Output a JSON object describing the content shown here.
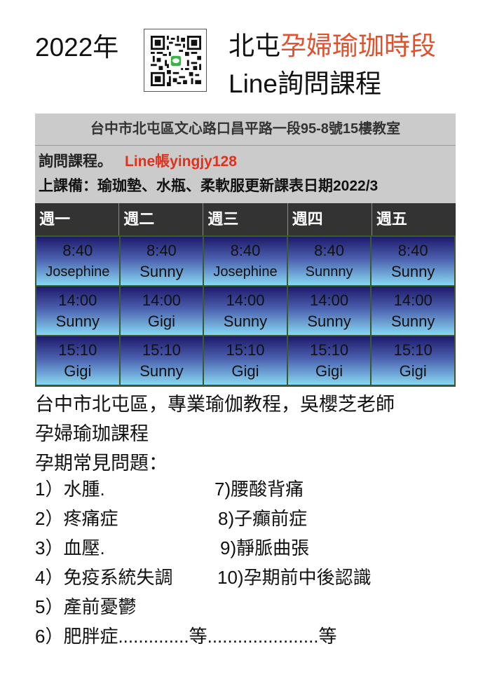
{
  "header": {
    "year": "2022年",
    "qr_icon": "line-qr-code",
    "title_prefix": "北屯",
    "title_highlight": "孕婦瑜珈時段",
    "subtitle": "Line詢問課程",
    "highlight_color": "#e0522e"
  },
  "schedule": {
    "address": "台中市北屯區文心路口昌平路一段95-8號15樓教室",
    "inquiry_label": "詢問課程。",
    "line_account": "Line帳yingjy128",
    "bring_items": "上課備：瑜珈墊、水瓶、柔軟服更新課表日期2022/3",
    "days": [
      "週一",
      "週二",
      "週三",
      "週四",
      "週五"
    ],
    "rows": [
      [
        {
          "time": "8:40",
          "teacher": "Josephine"
        },
        {
          "time": "8:40",
          "teacher": "Sunny"
        },
        {
          "time": "8:40",
          "teacher": "Josephine"
        },
        {
          "time": "8:40",
          "teacher": "Sunnny"
        },
        {
          "time": "8:40",
          "teacher": "Sunny"
        }
      ],
      [
        {
          "time": "14:00",
          "teacher": "Sunny"
        },
        {
          "time": "14:00",
          "teacher": "Gigi"
        },
        {
          "time": "14:00",
          "teacher": "Sunny"
        },
        {
          "time": "14:00",
          "teacher": "Sunny"
        },
        {
          "time": "14:00",
          "teacher": "Sunny"
        }
      ],
      [
        {
          "time": "15:10",
          "teacher": "Gigi"
        },
        {
          "time": "15:10",
          "teacher": "Sunny"
        },
        {
          "time": "15:10",
          "teacher": "Gigi"
        },
        {
          "time": "15:10",
          "teacher": "Gigi"
        },
        {
          "time": "15:10",
          "teacher": "Gigi"
        }
      ]
    ]
  },
  "description": {
    "line1": "台中市北屯區，專業瑜伽教程，吳櫻芝老師",
    "line2": "孕婦瑜珈課程",
    "line3": "孕期常見問題："
  },
  "issues": [
    {
      "left": "1）水腫.",
      "right": "7)腰酸背痛"
    },
    {
      "left": "2）疼痛症",
      "right": "8)子癲前症"
    },
    {
      "left": "3）血壓.",
      "right": "9)靜脈曲張"
    },
    {
      "left": "4）免疫系統失調",
      "right": "10)孕期前中後認識"
    },
    {
      "left": "5）產前憂鬱",
      "right": ""
    },
    {
      "left": "6）肥胖症..............等......................等",
      "right": ""
    }
  ]
}
